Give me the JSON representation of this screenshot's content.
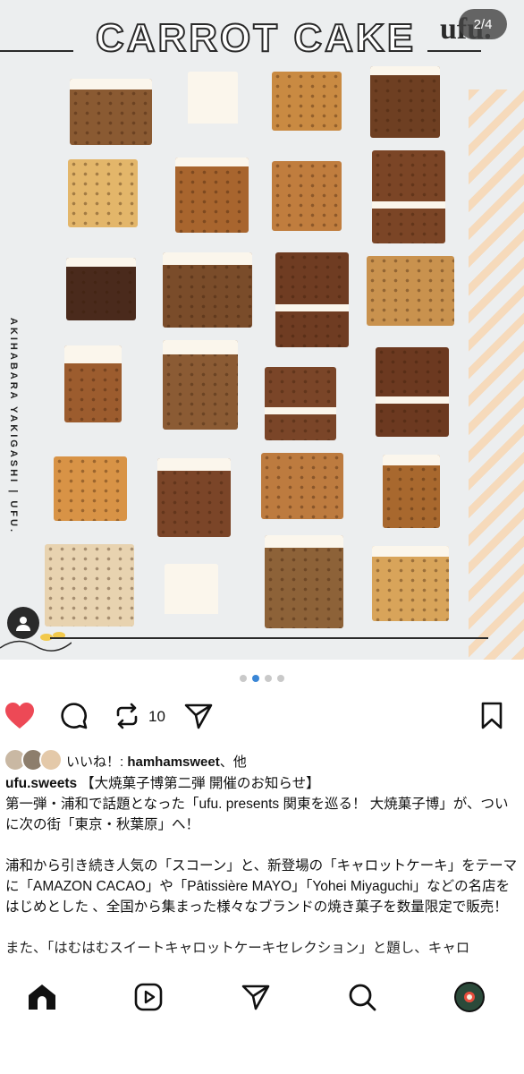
{
  "post_image": {
    "title": "CARROT CAKE",
    "brand": "ufu.",
    "vertical_text": "AKIHABARA YAKIGASHI | UFU.",
    "page_counter": "2/4"
  },
  "carousel": {
    "total": 4,
    "active_index": 1
  },
  "actions": {
    "repost_count": "10"
  },
  "likes": {
    "prefix": "いいね！: ",
    "user": "hamhamsweet",
    "suffix": "、他"
  },
  "caption": {
    "username": "ufu.sweets",
    "line1_rest": "【大焼菓子博第二弾 開催のお知らせ】",
    "para1": "第一弾・浦和で話題となった「ufu. presents 関東を巡る！ 大焼菓子博」が、ついに次の街「東京・秋葉原」へ！",
    "para2": "浦和から引き続き人気の「スコーン」と、新登場の「キャロットケーキ」をテーマに「AMAZON CACAO」や「Pâtissière MAYO」「Yohei Miyaguchi」などの名店をはじめとした 、全国から集まった様々なブランドの焼き菓子を数量限定で販売！",
    "para3_partial": "また、「はむはむスイートキャロットケーキセレクション」と題し、キャロ"
  },
  "colors": {
    "like_red": "#ed4956",
    "active_dot": "#3a86d6",
    "stripe": "#f6d9b8"
  },
  "icons": [
    "heart-icon",
    "comment-icon",
    "repost-icon",
    "share-icon",
    "bookmark-icon",
    "home-icon",
    "reels-icon",
    "send-icon",
    "search-icon",
    "profile-icon",
    "user-tag-icon"
  ]
}
